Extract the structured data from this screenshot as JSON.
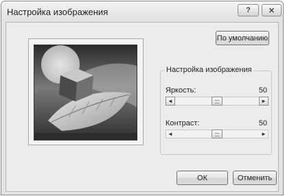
{
  "window": {
    "title": "Настройка изображения",
    "help_label": "?",
    "close_label": "✕"
  },
  "buttons": {
    "default": "По умолчанию",
    "ok": "ОК",
    "cancel": "Отменить"
  },
  "preview": {
    "description_icon": "preview-image"
  },
  "settings": {
    "group_title": "Настройка изображения",
    "brightness": {
      "label": "Яркость:",
      "value": "50",
      "level": 0.5,
      "left_arrow": "◄",
      "right_arrow": "►"
    },
    "contrast": {
      "label": "Контраст:",
      "value": "50",
      "level": 0.5,
      "left_arrow": "◄",
      "right_arrow": "►"
    }
  }
}
